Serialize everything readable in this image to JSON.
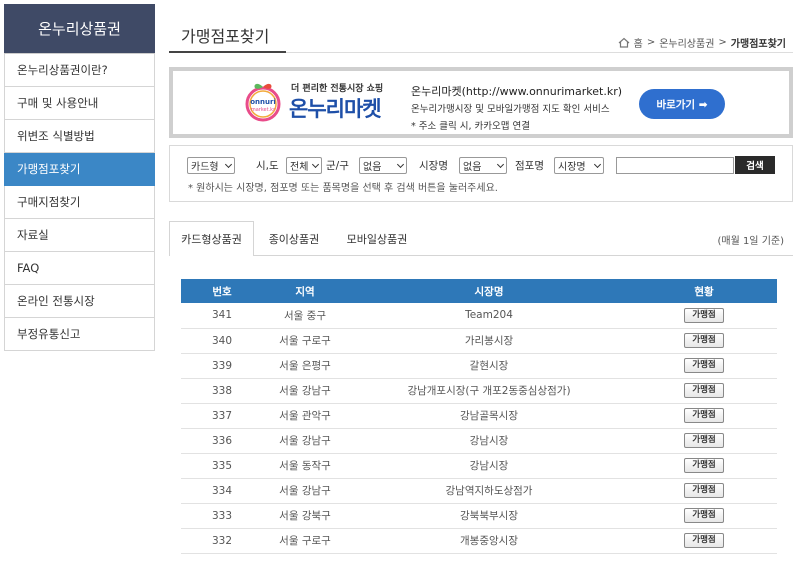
{
  "sidebar": {
    "title": "온누리상품권",
    "items": [
      {
        "label": "온누리상품권이란?"
      },
      {
        "label": "구매 및 사용안내"
      },
      {
        "label": "위변조 식별방법"
      },
      {
        "label": "가맹점포찾기"
      },
      {
        "label": "구매지점찾기"
      },
      {
        "label": "자료실"
      },
      {
        "label": "FAQ"
      },
      {
        "label": "온라인 전통시장"
      },
      {
        "label": "부정유통신고"
      }
    ]
  },
  "header": {
    "title": "가맹점포찾기",
    "breadcrumb": [
      "홈",
      ">",
      "온누리상품권",
      ">",
      "가맹점포찾기"
    ]
  },
  "banner": {
    "tagline": "더 편리한 전통시장 쇼핑",
    "brand": "온누리마켓",
    "logo_text": "onnuri market.kr",
    "url_text": "온누리마켓(http://www.onnurimarket.kr)",
    "desc": "온누리가맹시장 및 모바일가맹점 지도 확인 서비스",
    "note": "* 주소 클릭 시, 카카오맵 연결",
    "button": "바로가기 ➡"
  },
  "search": {
    "type_select": "카드형",
    "sido_label": "시,도",
    "sido_select": "전체",
    "gungu_label": "군/구",
    "gungu_select": "없음",
    "market_label": "시장명",
    "market_select": "없음",
    "store_label": "점포명",
    "field_select": "시장명",
    "input_value": "",
    "button": "검색",
    "hint": "* 원하시는 시장명, 점포명 또는 품목명을 선택 후 검색 버튼을 눌러주세요."
  },
  "tabs": [
    {
      "label": "카드형상품권"
    },
    {
      "label": "종이상품권"
    },
    {
      "label": "모바일상품권"
    }
  ],
  "tab_note": "(매월 1일 기준)",
  "table": {
    "headers": [
      "번호",
      "지역",
      "시장명",
      "현황"
    ],
    "rows": [
      {
        "no": "341",
        "region": "서울 중구",
        "market": "Team204",
        "status": "가맹점"
      },
      {
        "no": "340",
        "region": "서울 구로구",
        "market": "가리봉시장",
        "status": "가맹점"
      },
      {
        "no": "339",
        "region": "서울 은평구",
        "market": "갈현시장",
        "status": "가맹점"
      },
      {
        "no": "338",
        "region": "서울 강남구",
        "market": "강남개포시장(구 개포2동중심상점가)",
        "status": "가맹점"
      },
      {
        "no": "337",
        "region": "서울 관악구",
        "market": "강남골목시장",
        "status": "가맹점"
      },
      {
        "no": "336",
        "region": "서울 강남구",
        "market": "강남시장",
        "status": "가맹점"
      },
      {
        "no": "335",
        "region": "서울 동작구",
        "market": "강남시장",
        "status": "가맹점"
      },
      {
        "no": "334",
        "region": "서울 강남구",
        "market": "강남역지하도상점가",
        "status": "가맹점"
      },
      {
        "no": "333",
        "region": "서울 강북구",
        "market": "강북북부시장",
        "status": "가맹점"
      },
      {
        "no": "332",
        "region": "서울 구로구",
        "market": "개봉중앙시장",
        "status": "가맹점"
      }
    ]
  }
}
